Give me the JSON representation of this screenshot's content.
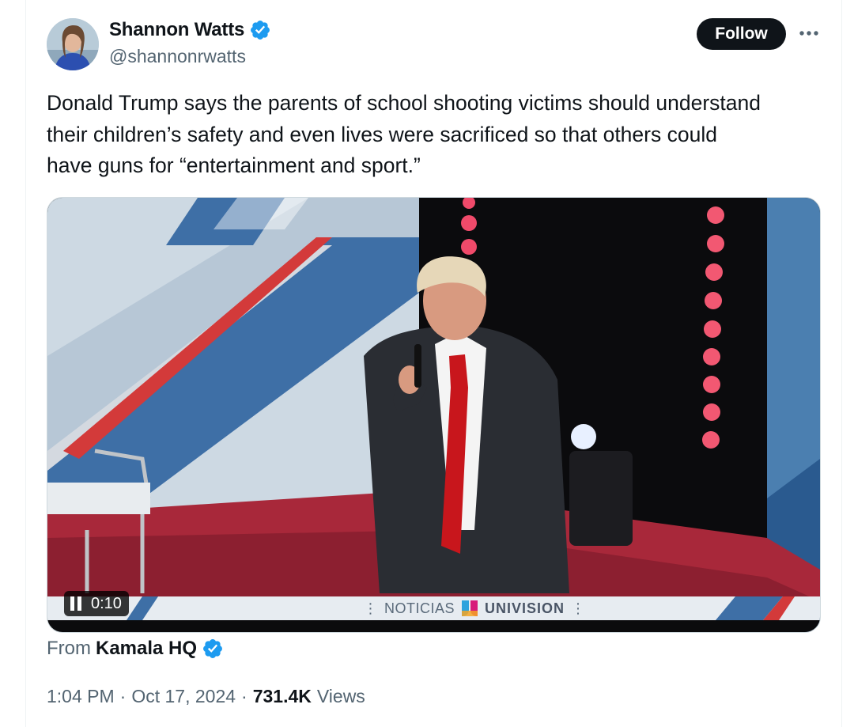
{
  "author": {
    "name": "Shannon Watts",
    "handle": "@shannonrwatts",
    "verified": true
  },
  "actions": {
    "follow_label": "Follow",
    "more_icon": "more-horizontal-icon"
  },
  "tweet": {
    "text": "Donald Trump says the parents of school shooting victims should understand\ntheir children’s safety and even lives were sacrificed so that others could\nhave guns for “entertainment and sport.”"
  },
  "media": {
    "type": "video",
    "timestamp": "0:10",
    "state": "playing",
    "lower_third": {
      "left": "NOTICIAS",
      "right": "UNIVISION"
    }
  },
  "attribution": {
    "from_label": "From",
    "source_name": "Kamala HQ",
    "verified": true
  },
  "meta": {
    "time": "1:04 PM",
    "date": "Oct 17, 2024",
    "views_count": "731.4K",
    "views_label": "Views"
  },
  "colors": {
    "verified_blue": "#1d9bf0",
    "text_primary": "#0f1419",
    "text_secondary": "#536471",
    "follow_bg": "#0f1419"
  }
}
